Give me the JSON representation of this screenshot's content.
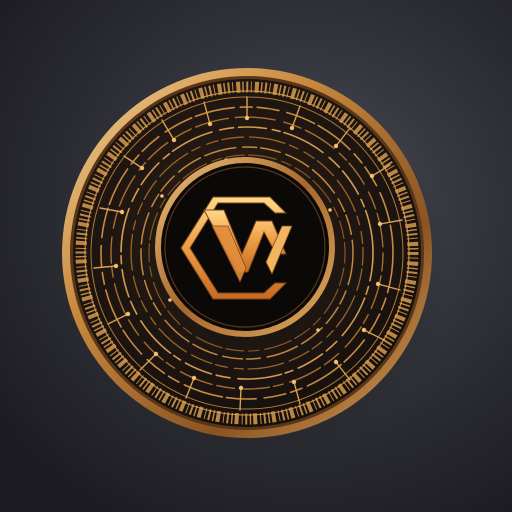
{
  "scene": {
    "subject": "coin",
    "emblem_icon": "hexagonal-cw-monogram-icon",
    "colors": {
      "background_center": "#4a4a55",
      "background_edge": "#1c1c22",
      "gold_light": "#f4c97a",
      "gold_mid": "#c8893e",
      "gold_dark": "#6b3e14",
      "coin_face": "#1a1411",
      "center_disc": "#0b0908"
    }
  }
}
